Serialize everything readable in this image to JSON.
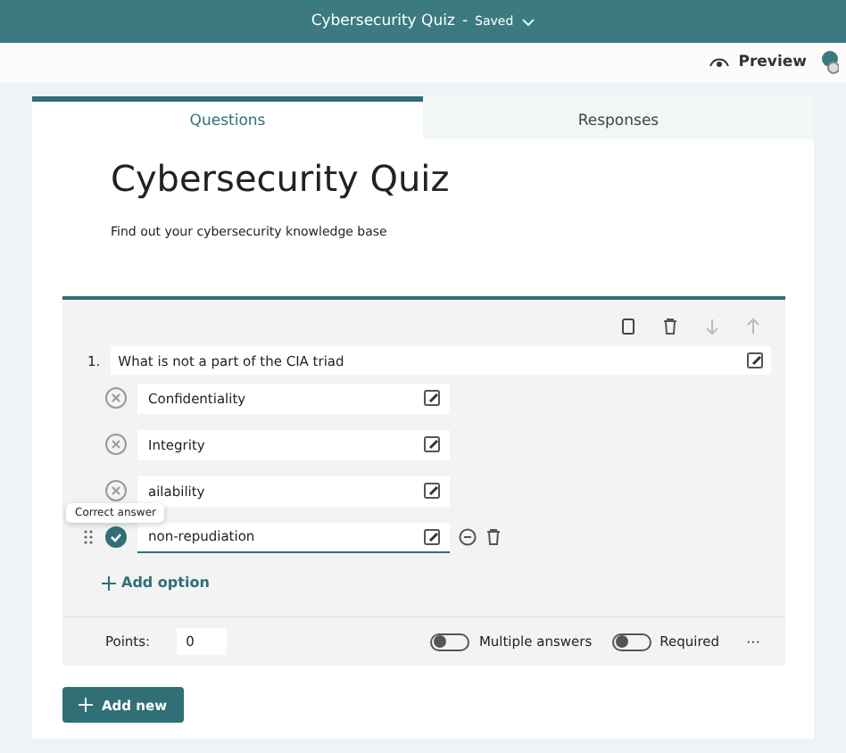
{
  "header": {
    "title": "Cybersecurity Quiz",
    "separator": "-",
    "status": "Saved"
  },
  "toolbar": {
    "preview": "Preview"
  },
  "tabs": [
    {
      "label": "Questions",
      "selected": true
    },
    {
      "label": "Responses",
      "selected": false
    }
  ],
  "form": {
    "title": "Cybersecurity Quiz",
    "description": "Find out your cybersecurity knowledge base"
  },
  "question": {
    "number": "1.",
    "text": "What is not a part of the CIA triad",
    "options": [
      {
        "text": "Confidentiality",
        "correct": false
      },
      {
        "text": "Integrity",
        "correct": false
      },
      {
        "text": "ailability",
        "correct": false
      },
      {
        "text": "non-repudiation",
        "correct": true
      }
    ],
    "tooltip": "Correct answer",
    "add_option": "Add option",
    "points_label": "Points:",
    "points": "0",
    "toggles": [
      {
        "label": "Multiple answers",
        "on": false
      },
      {
        "label": "Required",
        "on": false
      }
    ],
    "more": "···"
  },
  "add_new": "Add new"
}
